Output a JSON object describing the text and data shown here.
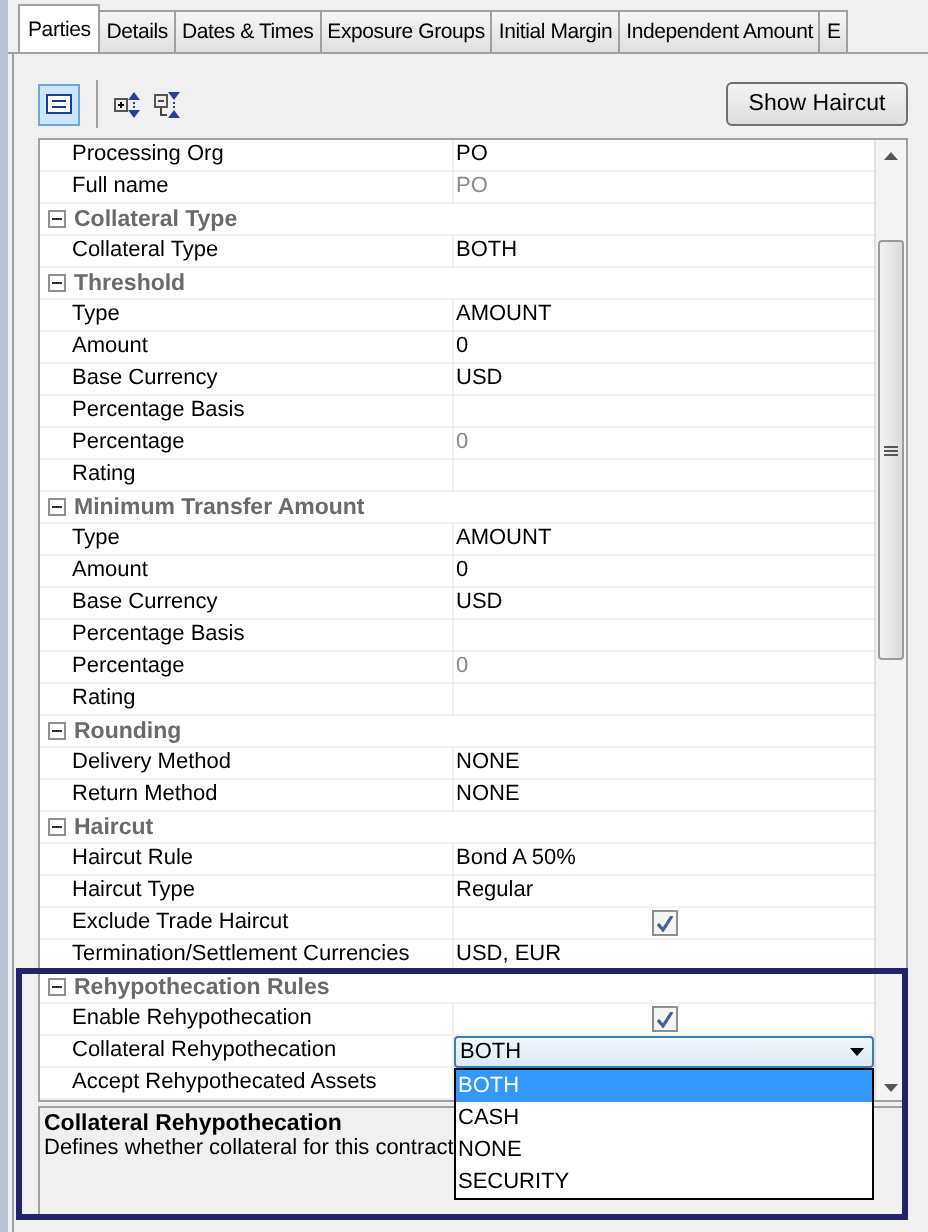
{
  "tabs": [
    {
      "label": "Parties",
      "selected": true
    },
    {
      "label": "Details",
      "selected": false
    },
    {
      "label": "Dates & Times",
      "selected": false
    },
    {
      "label": "Exposure Groups",
      "selected": false
    },
    {
      "label": "Initial Margin",
      "selected": false
    },
    {
      "label": "Independent Amount",
      "selected": false
    },
    {
      "label": "E",
      "selected": false
    }
  ],
  "toolbar": {
    "categorized_view": {
      "selected": true
    },
    "show_haircut_button": "Show Haircut"
  },
  "grid": {
    "sections": [
      {
        "rows": [
          {
            "kind": "text",
            "name": "Processing Org",
            "value": "PO"
          },
          {
            "kind": "text",
            "name": "Full name",
            "value": "PO",
            "muted": true
          }
        ]
      },
      {
        "title": "Collateral Type",
        "expanded": true,
        "rows": [
          {
            "kind": "text",
            "name": "Collateral Type",
            "value": "BOTH"
          }
        ]
      },
      {
        "title": "Threshold",
        "expanded": true,
        "rows": [
          {
            "kind": "text",
            "name": "Type",
            "value": "AMOUNT"
          },
          {
            "kind": "text",
            "name": "Amount",
            "value": "0"
          },
          {
            "kind": "text",
            "name": "Base Currency",
            "value": "USD"
          },
          {
            "kind": "text",
            "name": "Percentage Basis"
          },
          {
            "kind": "text",
            "name": "Percentage",
            "value": "0",
            "muted": true
          },
          {
            "kind": "text",
            "name": "Rating"
          }
        ]
      },
      {
        "title": "Minimum Transfer Amount",
        "expanded": true,
        "rows": [
          {
            "kind": "text",
            "name": "Type",
            "value": "AMOUNT"
          },
          {
            "kind": "text",
            "name": "Amount",
            "value": "0"
          },
          {
            "kind": "text",
            "name": "Base Currency",
            "value": "USD"
          },
          {
            "kind": "text",
            "name": "Percentage Basis"
          },
          {
            "kind": "text",
            "name": "Percentage",
            "value": "0",
            "muted": true
          },
          {
            "kind": "text",
            "name": "Rating"
          }
        ]
      },
      {
        "title": "Rounding",
        "expanded": true,
        "rows": [
          {
            "kind": "text",
            "name": "Delivery Method",
            "value": "NONE"
          },
          {
            "kind": "text",
            "name": "Return Method",
            "value": "NONE"
          }
        ]
      },
      {
        "title": "Haircut",
        "expanded": true,
        "rows": [
          {
            "kind": "text",
            "name": "Haircut Rule",
            "value": "Bond A 50%"
          },
          {
            "kind": "text",
            "name": "Haircut Type",
            "value": "Regular"
          },
          {
            "kind": "checkbox",
            "name": "Exclude Trade Haircut",
            "checked": true
          },
          {
            "kind": "text",
            "name": "Termination/Settlement Currencies",
            "value": "USD, EUR"
          }
        ]
      },
      {
        "title": "Rehypothecation Rules",
        "expanded": true,
        "rows": [
          {
            "kind": "checkbox",
            "name": "Enable Rehypothecation",
            "checked": true
          },
          {
            "kind": "combo",
            "name": "Collateral Rehypothecation",
            "value": "BOTH",
            "open": true,
            "options": [
              {
                "label": "BOTH",
                "selected": true
              },
              {
                "label": "CASH",
                "selected": false
              },
              {
                "label": "NONE",
                "selected": false
              },
              {
                "label": "SECURITY",
                "selected": false
              }
            ]
          },
          {
            "kind": "text",
            "name": "Accept Rehypothecated Assets"
          }
        ]
      }
    ]
  },
  "description": {
    "title": "Collateral Rehypothecation",
    "text": "Defines whether collateral for this contract"
  }
}
